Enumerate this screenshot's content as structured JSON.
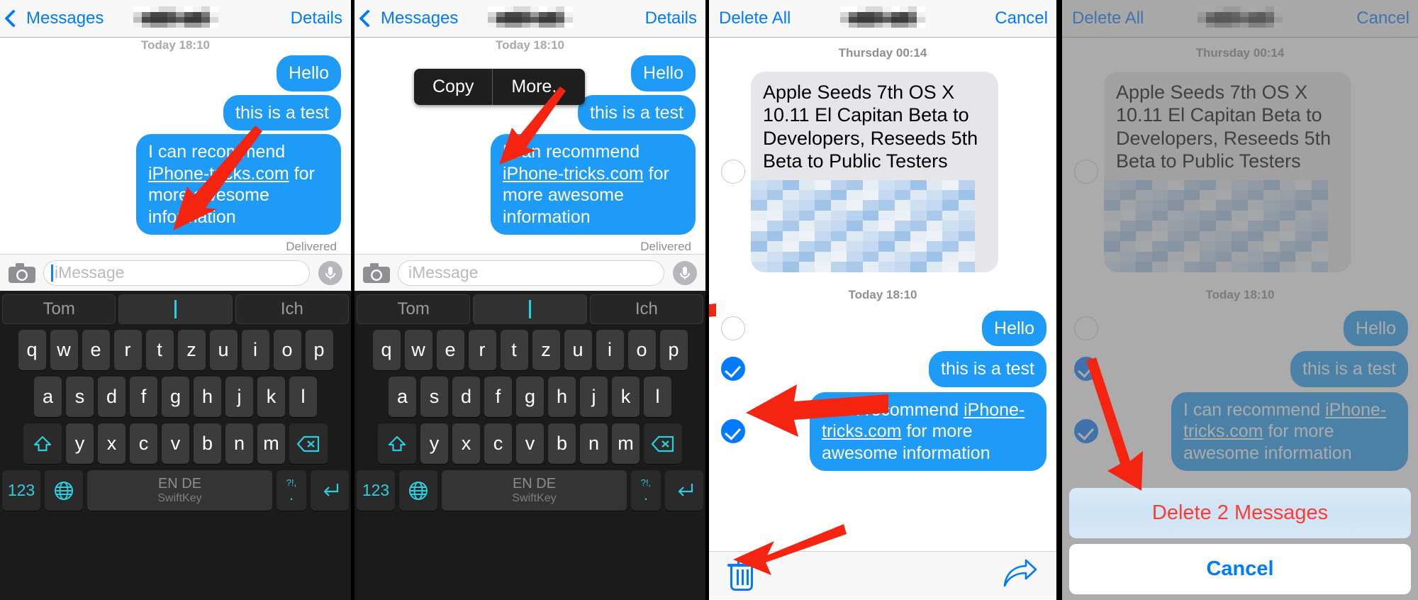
{
  "accent": {
    "ios_blue": "#007aff",
    "bubble_blue": "#1d9bf6",
    "destructive_red": "#ff3b30",
    "keyboard_cyan": "#2bd0e0"
  },
  "panel1": {
    "nav": {
      "back_label": "Messages",
      "title_redacted": "",
      "right_label": "Details"
    },
    "thread": {
      "timestamp_clipped": "Today 18:10",
      "messages": [
        {
          "text": "Hello",
          "side": "out"
        },
        {
          "text": "this is a test",
          "side": "out"
        },
        {
          "text": "I can recommend iPhone-tricks.com for more awesome information",
          "link": "iPhone-tricks.com",
          "side": "out"
        }
      ],
      "status": "Delivered"
    },
    "input": {
      "placeholder": "iMessage",
      "value": ""
    },
    "keyboard": {
      "predictions": [
        "Tom",
        "I",
        "Ich"
      ],
      "row1": [
        "q",
        "w",
        "e",
        "r",
        "t",
        "z",
        "u",
        "i",
        "o",
        "p"
      ],
      "row2": [
        "a",
        "s",
        "d",
        "f",
        "g",
        "h",
        "j",
        "k",
        "l"
      ],
      "row3": [
        "y",
        "x",
        "c",
        "v",
        "b",
        "n",
        "m"
      ],
      "shift_icon": "shift-icon",
      "backspace_icon": "backspace-icon",
      "numbers_label": "123",
      "globe_icon": "globe-icon",
      "space_label": "EN DE",
      "space_sub": "SwiftKey",
      "punct_top": "?!,",
      "punct_bottom": ".",
      "return_icon": "return-icon"
    }
  },
  "panel2": {
    "nav": {
      "back_label": "Messages",
      "title_redacted": "",
      "right_label": "Details"
    },
    "thread": {
      "timestamp_clipped": "Today 18:10",
      "messages": [
        {
          "text": "Hello",
          "side": "out"
        },
        {
          "text": "this is a test",
          "side": "out"
        },
        {
          "text": "I can recommend iPhone-tricks.com for more awesome information",
          "link": "iPhone-tricks.com",
          "side": "out"
        }
      ],
      "status": "Delivered"
    },
    "popup": {
      "copy": "Copy",
      "more": "More..."
    },
    "input": {
      "placeholder": "iMessage",
      "value": ""
    },
    "keyboard": {
      "predictions": [
        "Tom",
        "I",
        "Ich"
      ],
      "row1": [
        "q",
        "w",
        "e",
        "r",
        "t",
        "z",
        "u",
        "i",
        "o",
        "p"
      ],
      "row2": [
        "a",
        "s",
        "d",
        "f",
        "g",
        "h",
        "j",
        "k",
        "l"
      ],
      "row3": [
        "y",
        "x",
        "c",
        "v",
        "b",
        "n",
        "m"
      ],
      "numbers_label": "123",
      "space_label": "EN DE",
      "space_sub": "SwiftKey",
      "punct_top": "?!,",
      "punct_bottom": "."
    }
  },
  "panel3": {
    "nav": {
      "left_label": "Delete All",
      "title_redacted": "",
      "right_label": "Cancel"
    },
    "thread": {
      "timestamp_top": "Thursday 00:14",
      "timestamp_mid": "Today 18:10",
      "article": {
        "text": "Apple Seeds 7th OS X 10.11 El Capitan Beta to Developers, Reseeds 5th Beta to Public Testers",
        "selected": false
      },
      "messages": [
        {
          "text": "Hello",
          "side": "out",
          "selected": false
        },
        {
          "text": "this is a test",
          "side": "out",
          "selected": true
        },
        {
          "text": "I can recommend iPhone-tricks.com for more awesome information",
          "link": "iPhone-tricks.com",
          "side": "out",
          "selected": true
        }
      ]
    },
    "toolbar": {
      "trash_icon": "trash-icon",
      "forward_icon": "forward-arrow-icon"
    }
  },
  "panel4": {
    "nav": {
      "left_label": "Delete All",
      "title_redacted": "",
      "right_label": "Cancel"
    },
    "thread": {
      "timestamp_top": "Thursday 00:14",
      "timestamp_mid": "Today 18:10",
      "article": {
        "text": "Apple Seeds 7th OS X 10.11 El Capitan Beta to Developers, Reseeds 5th Beta to Public Testers",
        "selected": false
      },
      "messages": [
        {
          "text": "Hello",
          "side": "out",
          "selected": false
        },
        {
          "text": "this is a test",
          "side": "out",
          "selected": true
        },
        {
          "text": "I can recommend iPhone-tricks.com for more awesome",
          "link": "iPhone-tricks.com",
          "side": "out",
          "selected": true
        }
      ]
    },
    "action_sheet": {
      "delete_label": "Delete 2 Messages",
      "cancel_label": "Cancel"
    }
  }
}
